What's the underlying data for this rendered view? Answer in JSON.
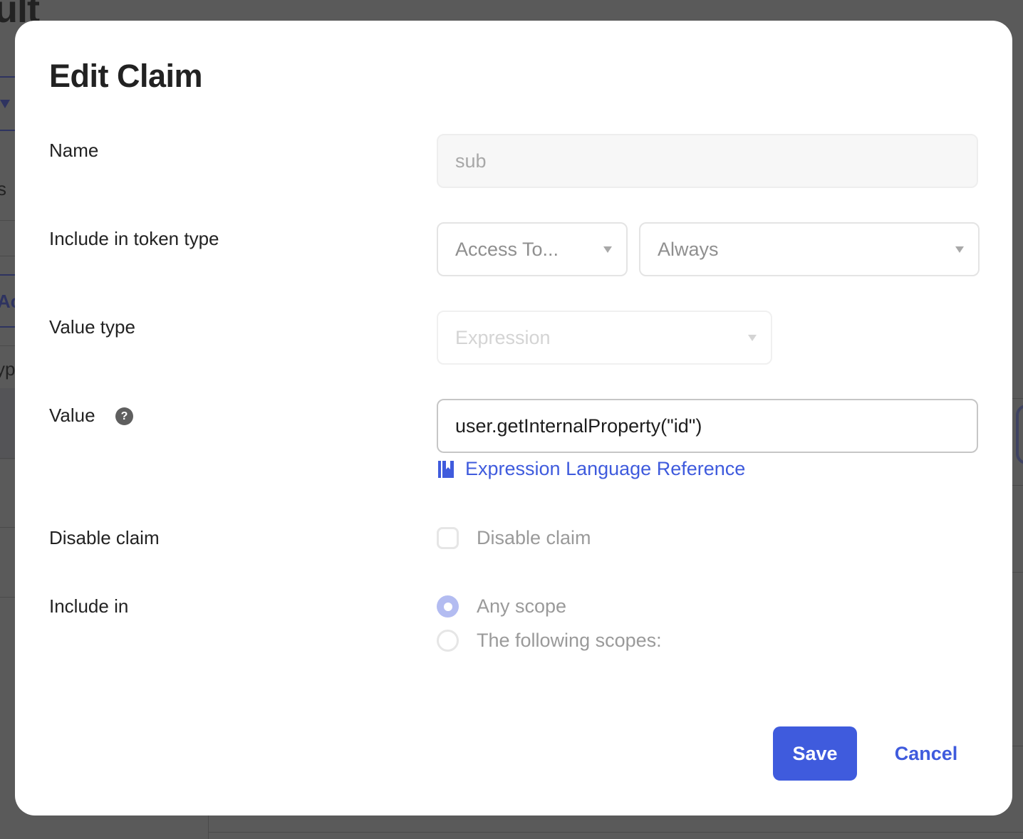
{
  "background": {
    "page_title_fragment": "ult",
    "fragments": [
      "s",
      "Ac",
      "yp"
    ]
  },
  "modal": {
    "title": "Edit Claim",
    "fields": {
      "name": {
        "label": "Name",
        "value": "sub",
        "disabled": true
      },
      "token_type": {
        "label": "Include in token type",
        "token_select_value": "Access To...",
        "condition_select_value": "Always"
      },
      "value_type": {
        "label": "Value type",
        "selected": "Expression",
        "disabled": true
      },
      "value": {
        "label": "Value",
        "help_icon": "?",
        "value": "user.getInternalProperty(\"id\")",
        "reference_link": "Expression Language Reference"
      },
      "disable_claim": {
        "label": "Disable claim",
        "checkbox_label": "Disable claim",
        "checked": false
      },
      "include_in": {
        "label": "Include in",
        "options": [
          {
            "label": "Any scope",
            "selected": true
          },
          {
            "label": "The following scopes:",
            "selected": false
          }
        ]
      }
    },
    "actions": {
      "save_label": "Save",
      "cancel_label": "Cancel"
    }
  },
  "colors": {
    "accent": "#3f5bdd",
    "radio_selected": "#b3bcf1",
    "overlay": "#5a5a5a",
    "text_primary": "#222222",
    "text_disabled": "#9a9a9a"
  }
}
